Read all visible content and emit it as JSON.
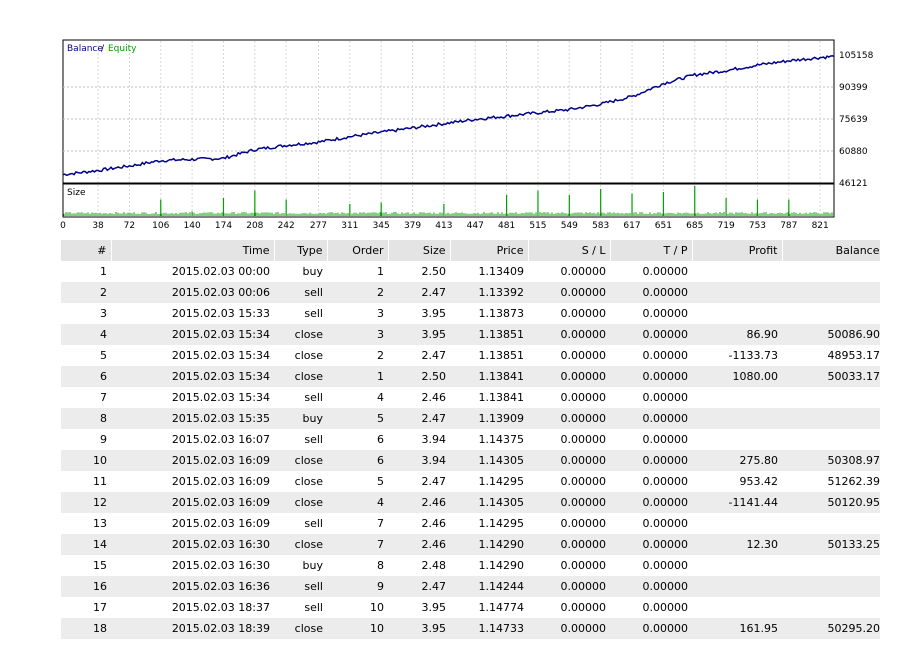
{
  "chart_data": [
    {
      "type": "line",
      "legend": [
        "Balance",
        "Equity"
      ],
      "colors": {
        "balance": "#00008b",
        "equity": "#00a000"
      },
      "ylim": [
        46121,
        105158
      ],
      "yticks": [
        "105158",
        "90399",
        "75639",
        "60880",
        "46121"
      ],
      "xlim": [
        0,
        836
      ],
      "series": [
        {
          "name": "Balance",
          "x": [
            0,
            40,
            80,
            106,
            140,
            174,
            208,
            242,
            277,
            311,
            345,
            379,
            413,
            447,
            481,
            515,
            549,
            583,
            617,
            651,
            685,
            719,
            753,
            787,
            821,
            836
          ],
          "values": [
            50000,
            52000,
            54500,
            56500,
            57000,
            57500,
            61500,
            63500,
            65000,
            67500,
            69500,
            71500,
            73500,
            75500,
            77000,
            78500,
            80000,
            82500,
            86000,
            92000,
            96000,
            98000,
            100500,
            102500,
            104000,
            104500
          ]
        }
      ]
    },
    {
      "type": "bar",
      "title": "Size",
      "xlim": [
        0,
        836
      ],
      "xticks": [
        "0",
        "38",
        "72",
        "106",
        "140",
        "174",
        "208",
        "242",
        "277",
        "311",
        "345",
        "379",
        "413",
        "447",
        "481",
        "515",
        "549",
        "583",
        "617",
        "651",
        "685",
        "719",
        "753",
        "787",
        "821"
      ],
      "spikes": [
        {
          "x": 106,
          "v": 0.55
        },
        {
          "x": 140,
          "v": 0.15
        },
        {
          "x": 174,
          "v": 0.6
        },
        {
          "x": 208,
          "v": 0.85
        },
        {
          "x": 242,
          "v": 0.55
        },
        {
          "x": 311,
          "v": 0.4
        },
        {
          "x": 345,
          "v": 0.45
        },
        {
          "x": 413,
          "v": 0.4
        },
        {
          "x": 481,
          "v": 0.7
        },
        {
          "x": 515,
          "v": 0.85
        },
        {
          "x": 549,
          "v": 0.7
        },
        {
          "x": 583,
          "v": 0.9
        },
        {
          "x": 617,
          "v": 0.75
        },
        {
          "x": 651,
          "v": 0.8
        },
        {
          "x": 685,
          "v": 1.0
        },
        {
          "x": 719,
          "v": 0.6
        },
        {
          "x": 753,
          "v": 0.55
        },
        {
          "x": 787,
          "v": 0.55
        }
      ]
    }
  ],
  "table": {
    "headers": [
      "#",
      "Time",
      "Type",
      "Order",
      "Size",
      "Price",
      "S / L",
      "T / P",
      "Profit",
      "Balance"
    ],
    "rows": [
      [
        "1",
        "2015.02.03 00:00",
        "buy",
        "1",
        "2.50",
        "1.13409",
        "0.00000",
        "0.00000",
        "",
        ""
      ],
      [
        "2",
        "2015.02.03 00:06",
        "sell",
        "2",
        "2.47",
        "1.13392",
        "0.00000",
        "0.00000",
        "",
        ""
      ],
      [
        "3",
        "2015.02.03 15:33",
        "sell",
        "3",
        "3.95",
        "1.13873",
        "0.00000",
        "0.00000",
        "",
        ""
      ],
      [
        "4",
        "2015.02.03 15:34",
        "close",
        "3",
        "3.95",
        "1.13851",
        "0.00000",
        "0.00000",
        "86.90",
        "50086.90"
      ],
      [
        "5",
        "2015.02.03 15:34",
        "close",
        "2",
        "2.47",
        "1.13851",
        "0.00000",
        "0.00000",
        "-1133.73",
        "48953.17"
      ],
      [
        "6",
        "2015.02.03 15:34",
        "close",
        "1",
        "2.50",
        "1.13841",
        "0.00000",
        "0.00000",
        "1080.00",
        "50033.17"
      ],
      [
        "7",
        "2015.02.03 15:34",
        "sell",
        "4",
        "2.46",
        "1.13841",
        "0.00000",
        "0.00000",
        "",
        ""
      ],
      [
        "8",
        "2015.02.03 15:35",
        "buy",
        "5",
        "2.47",
        "1.13909",
        "0.00000",
        "0.00000",
        "",
        ""
      ],
      [
        "9",
        "2015.02.03 16:07",
        "sell",
        "6",
        "3.94",
        "1.14375",
        "0.00000",
        "0.00000",
        "",
        ""
      ],
      [
        "10",
        "2015.02.03 16:09",
        "close",
        "6",
        "3.94",
        "1.14305",
        "0.00000",
        "0.00000",
        "275.80",
        "50308.97"
      ],
      [
        "11",
        "2015.02.03 16:09",
        "close",
        "5",
        "2.47",
        "1.14295",
        "0.00000",
        "0.00000",
        "953.42",
        "51262.39"
      ],
      [
        "12",
        "2015.02.03 16:09",
        "close",
        "4",
        "2.46",
        "1.14305",
        "0.00000",
        "0.00000",
        "-1141.44",
        "50120.95"
      ],
      [
        "13",
        "2015.02.03 16:09",
        "sell",
        "7",
        "2.46",
        "1.14295",
        "0.00000",
        "0.00000",
        "",
        ""
      ],
      [
        "14",
        "2015.02.03 16:30",
        "close",
        "7",
        "2.46",
        "1.14290",
        "0.00000",
        "0.00000",
        "12.30",
        "50133.25"
      ],
      [
        "15",
        "2015.02.03 16:30",
        "buy",
        "8",
        "2.48",
        "1.14290",
        "0.00000",
        "0.00000",
        "",
        ""
      ],
      [
        "16",
        "2015.02.03 16:36",
        "sell",
        "9",
        "2.47",
        "1.14244",
        "0.00000",
        "0.00000",
        "",
        ""
      ],
      [
        "17",
        "2015.02.03 18:37",
        "sell",
        "10",
        "3.95",
        "1.14774",
        "0.00000",
        "0.00000",
        "",
        ""
      ],
      [
        "18",
        "2015.02.03 18:39",
        "close",
        "10",
        "3.95",
        "1.14733",
        "0.00000",
        "0.00000",
        "161.95",
        "50295.20"
      ]
    ]
  }
}
